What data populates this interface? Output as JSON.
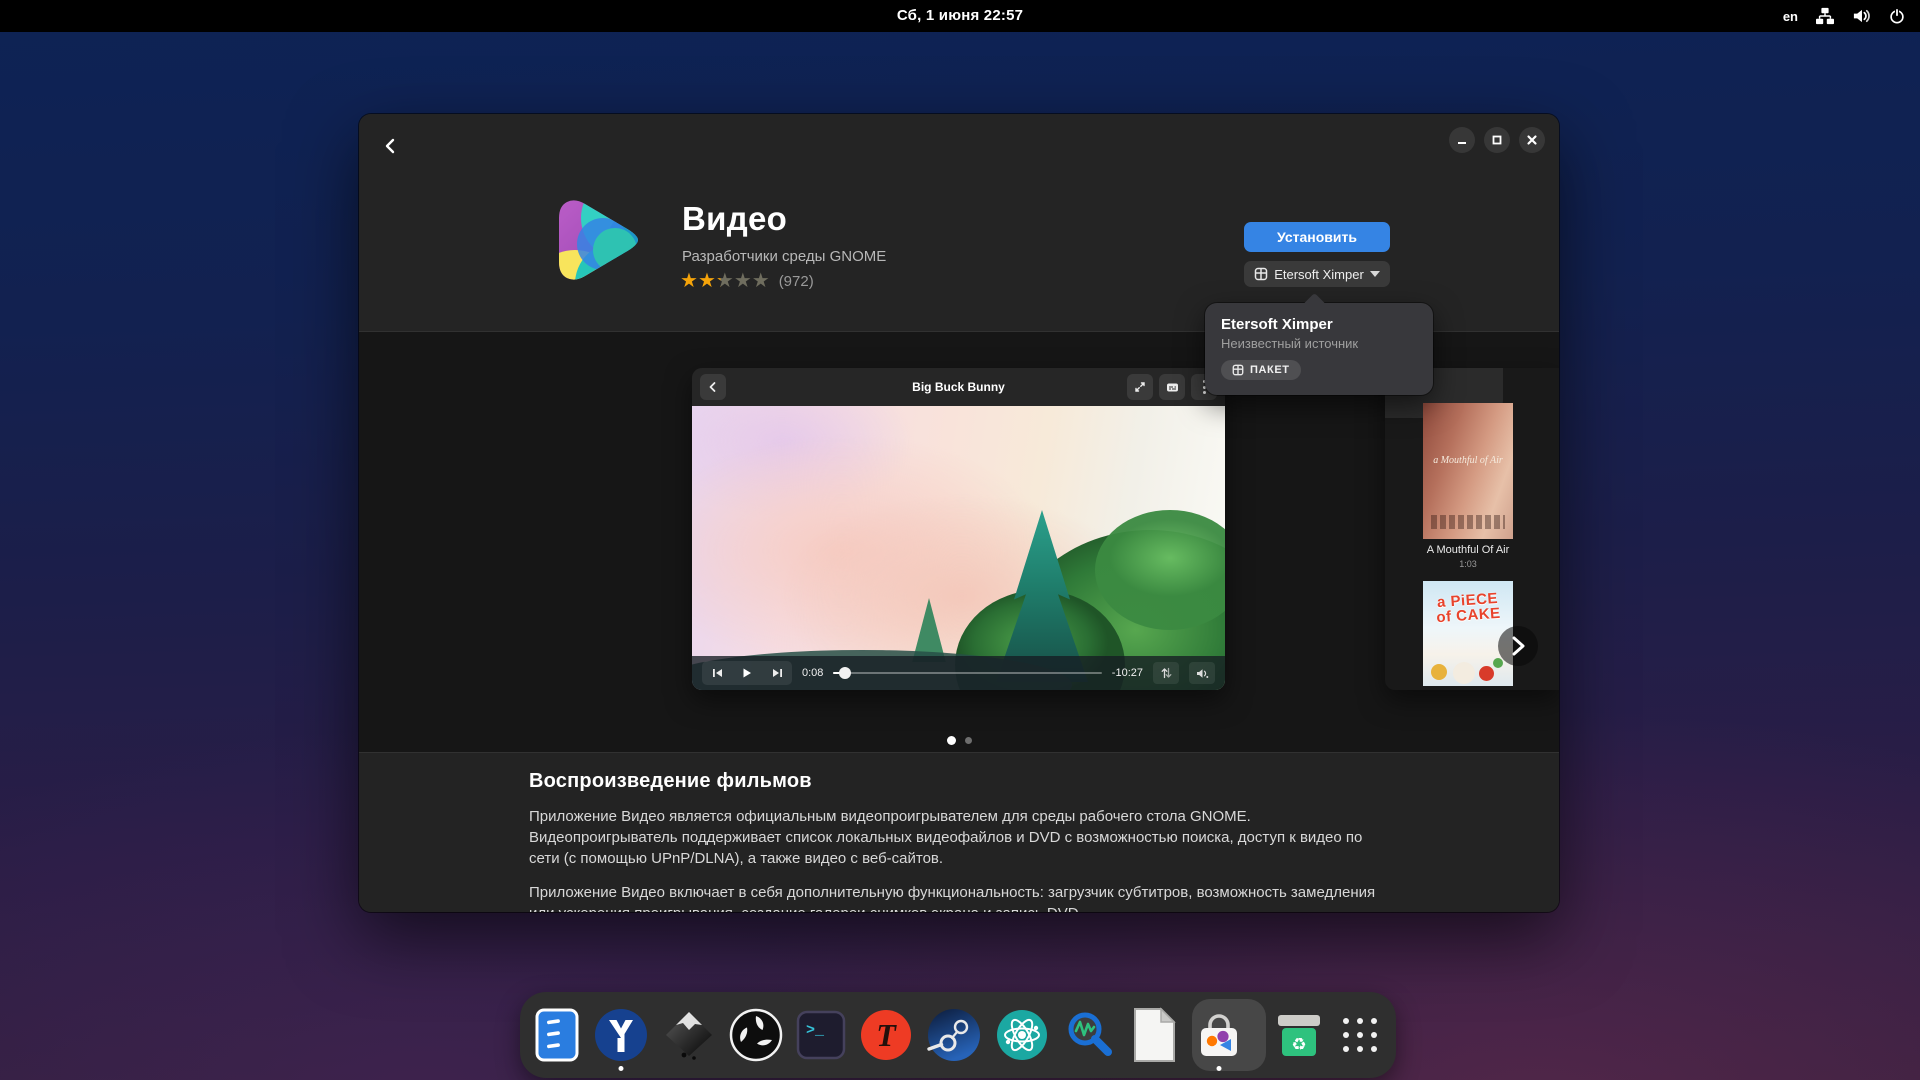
{
  "topbar": {
    "clock": "Сб, 1 июня  22:57",
    "keyboard_layout": "en",
    "status_icons": [
      "network-wired-icon",
      "volume-icon",
      "power-icon"
    ]
  },
  "app_page": {
    "title": "Видео",
    "developer": "Разработчики среды GNOME",
    "rating": {
      "stars_percent": [
        100,
        100,
        25,
        0,
        0
      ],
      "count_label": "(972)"
    },
    "install_label": "Установить",
    "source_label": "Etersoft Ximper",
    "source_popover": {
      "name": "Etersoft Ximper",
      "origin": "Неизвестный источник",
      "badge": "ПАКЕТ"
    },
    "carousel": {
      "pages": 2,
      "active_page": 0,
      "player": {
        "title": "Big Buck Bunny",
        "elapsed": "0:08",
        "remaining": "-10:27",
        "progress_percent": 3
      },
      "library": {
        "poster1": {
          "overlay": "a Mouthful of Air",
          "caption": "A Mouthful Of Air",
          "duration": "1:03"
        },
        "poster2": {
          "overlay_line1": "a PiECE",
          "overlay_line2": "of CAKE"
        }
      }
    },
    "description": {
      "heading": "Воспроизведение фильмов",
      "paragraph1": "Приложение Видео является официальным видеопроигрывателем для среды рабочего стола GNOME. Видеопроигрыватель поддерживает список локальных видеофайлов и DVD с возможностью поиска, доступ к видео по сети (с помощью UPnP/DLNA), а также видео с веб-сайтов.",
      "paragraph2": "Приложение Видео включает в себя дополнительную функциональность: загрузчик субтитров, возможность замедления или ускорения проигрывания, создание галереи снимков экрана и запись DVD."
    }
  },
  "dock": {
    "items": [
      {
        "name": "blue-notes-app-icon",
        "running": false
      },
      {
        "name": "yandex-browser-icon",
        "running": true
      },
      {
        "name": "inkscape-icon",
        "running": false
      },
      {
        "name": "obs-studio-icon",
        "running": false
      },
      {
        "name": "terminal-icon",
        "running": false
      },
      {
        "name": "red-t-app-icon",
        "running": false
      },
      {
        "name": "steam-icon",
        "running": false
      },
      {
        "name": "atom-science-app-icon",
        "running": false
      },
      {
        "name": "log-monitor-icon",
        "running": false
      },
      {
        "name": "libreoffice-document-icon",
        "running": false
      },
      {
        "name": "gnome-software-icon",
        "running": true,
        "active": true
      },
      {
        "name": "trash-icon",
        "running": false
      },
      {
        "name": "app-grid-icon",
        "running": false
      }
    ]
  },
  "colors": {
    "accent": "#3584e4",
    "star_active": "#f5a40a",
    "star_inactive": "#6f6d5e",
    "topbar_bg": "#000000",
    "window_bg": "#242424",
    "popover_bg": "#38383c"
  }
}
